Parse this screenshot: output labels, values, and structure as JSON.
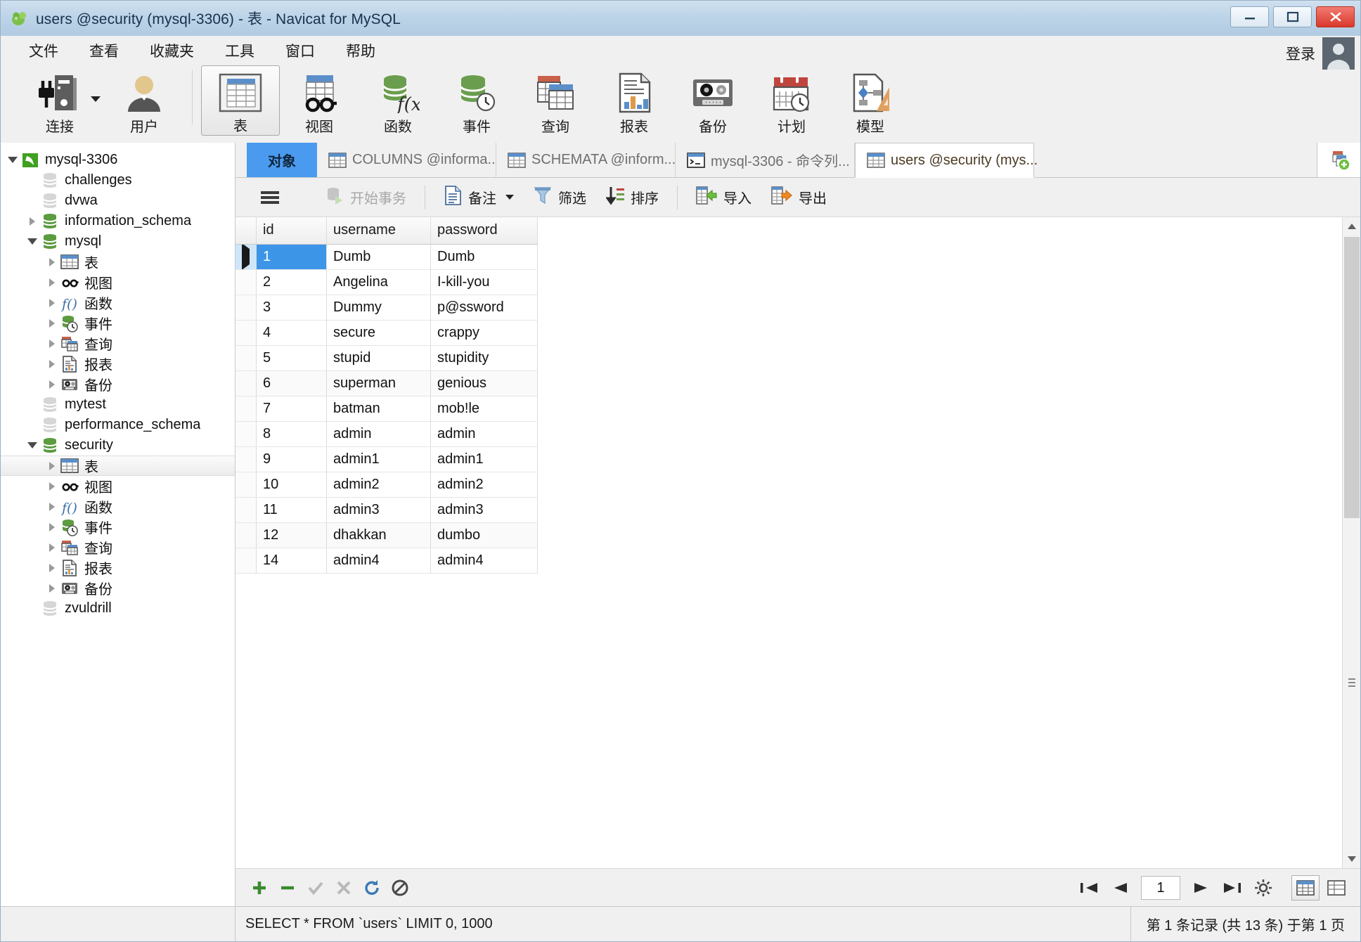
{
  "window": {
    "title": "users @security (mysql-3306) - 表 - Navicat for MySQL",
    "logo": "navicat-leaf-logo",
    "buttons": {
      "minimize": "minimize-icon",
      "maximize": "maximize-icon",
      "close": "close-icon"
    }
  },
  "menubar": {
    "items": [
      {
        "label": "文件",
        "name": "menu-file"
      },
      {
        "label": "查看",
        "name": "menu-view"
      },
      {
        "label": "收藏夹",
        "name": "menu-favorites"
      },
      {
        "label": "工具",
        "name": "menu-tools"
      },
      {
        "label": "窗口",
        "name": "menu-window"
      },
      {
        "label": "帮助",
        "name": "menu-help"
      }
    ],
    "login_label": "登录",
    "avatar": "user-avatar-icon"
  },
  "toolbar": {
    "items": [
      {
        "label": "连接",
        "icon": "connection-icon",
        "active": false,
        "dropdown": true
      },
      {
        "label": "用户",
        "icon": "user-icon",
        "active": false,
        "dropdown": false
      },
      {
        "label": "表",
        "icon": "table-icon",
        "active": true,
        "dropdown": false
      },
      {
        "label": "视图",
        "icon": "view-icon",
        "active": false,
        "dropdown": false
      },
      {
        "label": "函数",
        "icon": "function-icon",
        "active": false,
        "dropdown": false
      },
      {
        "label": "事件",
        "icon": "event-icon",
        "active": false,
        "dropdown": false
      },
      {
        "label": "查询",
        "icon": "query-icon",
        "active": false,
        "dropdown": false
      },
      {
        "label": "报表",
        "icon": "report-icon",
        "active": false,
        "dropdown": false
      },
      {
        "label": "备份",
        "icon": "backup-icon",
        "active": false,
        "dropdown": false
      },
      {
        "label": "计划",
        "icon": "schedule-icon",
        "active": false,
        "dropdown": false
      },
      {
        "label": "模型",
        "icon": "model-icon",
        "active": false,
        "dropdown": false
      }
    ]
  },
  "sidebar": {
    "nodes": [
      {
        "label": "mysql-3306",
        "indent": 0,
        "twisty": "open",
        "icon": "connection-green-icon",
        "selected": false
      },
      {
        "label": "challenges",
        "indent": 1,
        "twisty": "none",
        "icon": "database-gray-icon",
        "selected": false
      },
      {
        "label": "dvwa",
        "indent": 1,
        "twisty": "none",
        "icon": "database-gray-icon",
        "selected": false
      },
      {
        "label": "information_schema",
        "indent": 1,
        "twisty": "closed",
        "icon": "database-green-icon",
        "selected": false
      },
      {
        "label": "mysql",
        "indent": 1,
        "twisty": "open",
        "icon": "database-green-icon",
        "selected": false
      },
      {
        "label": "表",
        "indent": 2,
        "twisty": "closed",
        "icon": "table-icon",
        "selected": false
      },
      {
        "label": "视图",
        "indent": 2,
        "twisty": "closed",
        "icon": "view-icon",
        "selected": false
      },
      {
        "label": "函数",
        "indent": 2,
        "twisty": "closed",
        "icon": "function-icon",
        "selected": false
      },
      {
        "label": "事件",
        "indent": 2,
        "twisty": "closed",
        "icon": "event-icon",
        "selected": false
      },
      {
        "label": "查询",
        "indent": 2,
        "twisty": "closed",
        "icon": "query-icon",
        "selected": false
      },
      {
        "label": "报表",
        "indent": 2,
        "twisty": "closed",
        "icon": "report-icon",
        "selected": false
      },
      {
        "label": "备份",
        "indent": 2,
        "twisty": "closed",
        "icon": "backup-icon",
        "selected": false
      },
      {
        "label": "mytest",
        "indent": 1,
        "twisty": "none",
        "icon": "database-gray-icon",
        "selected": false
      },
      {
        "label": "performance_schema",
        "indent": 1,
        "twisty": "none",
        "icon": "database-gray-icon",
        "selected": false
      },
      {
        "label": "security",
        "indent": 1,
        "twisty": "open",
        "icon": "database-green-icon",
        "selected": false
      },
      {
        "label": "表",
        "indent": 2,
        "twisty": "closed",
        "icon": "table-icon",
        "selected": true
      },
      {
        "label": "视图",
        "indent": 2,
        "twisty": "closed",
        "icon": "view-icon",
        "selected": false
      },
      {
        "label": "函数",
        "indent": 2,
        "twisty": "closed",
        "icon": "function-icon",
        "selected": false
      },
      {
        "label": "事件",
        "indent": 2,
        "twisty": "closed",
        "icon": "event-icon",
        "selected": false
      },
      {
        "label": "查询",
        "indent": 2,
        "twisty": "closed",
        "icon": "query-icon",
        "selected": false
      },
      {
        "label": "报表",
        "indent": 2,
        "twisty": "closed",
        "icon": "report-icon",
        "selected": false
      },
      {
        "label": "备份",
        "indent": 2,
        "twisty": "closed",
        "icon": "backup-icon",
        "selected": false
      },
      {
        "label": "zvuldrill",
        "indent": 1,
        "twisty": "none",
        "icon": "database-gray-icon",
        "selected": false
      }
    ]
  },
  "tabs": {
    "object_tab": {
      "label": "对象",
      "name": "tab-objects"
    },
    "documents": [
      {
        "label": "COLUMNS @informa...",
        "icon": "table-icon",
        "current": false
      },
      {
        "label": "SCHEMATA @inform...",
        "icon": "table-icon",
        "current": false
      },
      {
        "label": "mysql-3306 - 命令列...",
        "icon": "console-icon",
        "current": false
      },
      {
        "label": "users @security (mys...",
        "icon": "table-icon",
        "current": true
      }
    ],
    "add_tab": "new-tab-icon"
  },
  "gridbar": {
    "menu_icon": "hamburger-menu-icon",
    "buttons": [
      {
        "label": "开始事务",
        "icon": "begin-transaction-icon",
        "disabled": true,
        "caret": false,
        "name": "begin-transaction-button"
      },
      {
        "label": "备注",
        "icon": "note-icon",
        "disabled": false,
        "caret": true,
        "name": "note-button"
      },
      {
        "label": "筛选",
        "icon": "filter-icon",
        "disabled": false,
        "caret": false,
        "name": "filter-button"
      },
      {
        "label": "排序",
        "icon": "sort-icon",
        "disabled": false,
        "caret": false,
        "name": "sort-button"
      },
      {
        "label": "导入",
        "icon": "import-icon",
        "disabled": false,
        "caret": false,
        "name": "import-button"
      },
      {
        "label": "导出",
        "icon": "export-icon",
        "disabled": false,
        "caret": false,
        "name": "export-button"
      }
    ]
  },
  "grid": {
    "columns": [
      "id",
      "username",
      "password"
    ],
    "selected_row_index": 0,
    "rows": [
      {
        "id": "1",
        "username": "Dumb",
        "password": "Dumb"
      },
      {
        "id": "2",
        "username": "Angelina",
        "password": "I-kill-you"
      },
      {
        "id": "3",
        "username": "Dummy",
        "password": "p@ssword"
      },
      {
        "id": "4",
        "username": "secure",
        "password": "crappy"
      },
      {
        "id": "5",
        "username": "stupid",
        "password": "stupidity"
      },
      {
        "id": "6",
        "username": "superman",
        "password": "genious"
      },
      {
        "id": "7",
        "username": "batman",
        "password": "mob!le"
      },
      {
        "id": "8",
        "username": "admin",
        "password": "admin"
      },
      {
        "id": "9",
        "username": "admin1",
        "password": "admin1"
      },
      {
        "id": "10",
        "username": "admin2",
        "password": "admin2"
      },
      {
        "id": "11",
        "username": "admin3",
        "password": "admin3"
      },
      {
        "id": "12",
        "username": "dhakkan",
        "password": "dumbo"
      },
      {
        "id": "14",
        "username": "admin4",
        "password": "admin4"
      }
    ]
  },
  "navbar": {
    "record_buttons": [
      {
        "icon": "add-record-icon",
        "name": "add-record-button",
        "disabled": false
      },
      {
        "icon": "delete-record-icon",
        "name": "delete-record-button",
        "disabled": false
      },
      {
        "icon": "apply-change-icon",
        "name": "apply-change-button",
        "disabled": true
      },
      {
        "icon": "cancel-change-icon",
        "name": "cancel-change-button",
        "disabled": true
      },
      {
        "icon": "refresh-icon",
        "name": "refresh-button",
        "disabled": false
      },
      {
        "icon": "stop-icon",
        "name": "stop-button",
        "disabled": false
      }
    ],
    "page_value": "1",
    "pager_buttons": [
      {
        "icon": "first-page-icon",
        "name": "first-page-button"
      },
      {
        "icon": "prev-page-icon",
        "name": "prev-page-button"
      },
      {
        "icon": "next-page-icon",
        "name": "next-page-button"
      },
      {
        "icon": "last-page-icon",
        "name": "last-page-button"
      },
      {
        "icon": "grid-settings-icon",
        "name": "grid-settings-button"
      }
    ],
    "view_modes": [
      {
        "icon": "grid-view-icon",
        "name": "grid-view-button",
        "active": true
      },
      {
        "icon": "form-view-icon",
        "name": "form-view-button",
        "active": false
      }
    ]
  },
  "statusbar": {
    "sql": "SELECT * FROM `users` LIMIT 0, 1000",
    "record_info": "第 1 条记录 (共 13 条) 于第 1 页"
  },
  "colors": {
    "title_bar": "#bdd4e8",
    "accent_blue": "#4a9bf0",
    "selection_blue": "#3d95e8",
    "db_green": "#5c9b4a",
    "close_red": "#d9382b",
    "header_blue_tint": "#ddeefb"
  }
}
